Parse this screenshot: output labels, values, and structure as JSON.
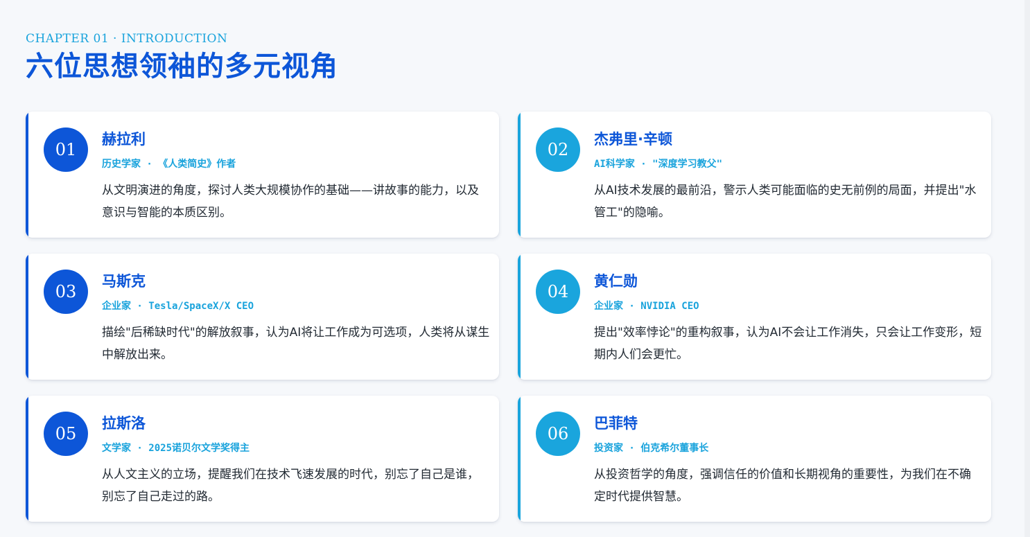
{
  "header": {
    "chapter": "CHAPTER 01 · INTRODUCTION",
    "title": "六位思想领袖的多元视角"
  },
  "colors": {
    "primary_blue": "#0d56d8",
    "accent_cyan": "#1aa5dd"
  },
  "cards": [
    {
      "number": "01",
      "name": "赫拉利",
      "role": "历史学家 · 《人类简史》作者",
      "description": "从文明演进的角度，探讨人类大规模协作的基础——讲故事的能力，以及意识与智能的本质区别。"
    },
    {
      "number": "02",
      "name": "杰弗里·辛顿",
      "role": "AI科学家 · \"深度学习教父\"",
      "description": "从AI技术发展的最前沿，警示人类可能面临的史无前例的局面，并提出\"水管工\"的隐喻。"
    },
    {
      "number": "03",
      "name": "马斯克",
      "role": "企业家 · Tesla/SpaceX/X CEO",
      "description": "描绘\"后稀缺时代\"的解放叙事，认为AI将让工作成为可选项，人类将从谋生中解放出来。"
    },
    {
      "number": "04",
      "name": "黄仁勋",
      "role": "企业家 · NVIDIA CEO",
      "description": "提出\"效率悖论\"的重构叙事，认为AI不会让工作消失，只会让工作变形，短期内人们会更忙。"
    },
    {
      "number": "05",
      "name": "拉斯洛",
      "role": "文学家 · 2025诺贝尔文学奖得主",
      "description": "从人文主义的立场，提醒我们在技术飞速发展的时代，别忘了自己是谁，别忘了自己走过的路。"
    },
    {
      "number": "06",
      "name": "巴菲特",
      "role": "投资家 · 伯克希尔董事长",
      "description": "从投资哲学的角度，强调信任的价值和长期视角的重要性，为我们在不确定时代提供智慧。"
    }
  ]
}
